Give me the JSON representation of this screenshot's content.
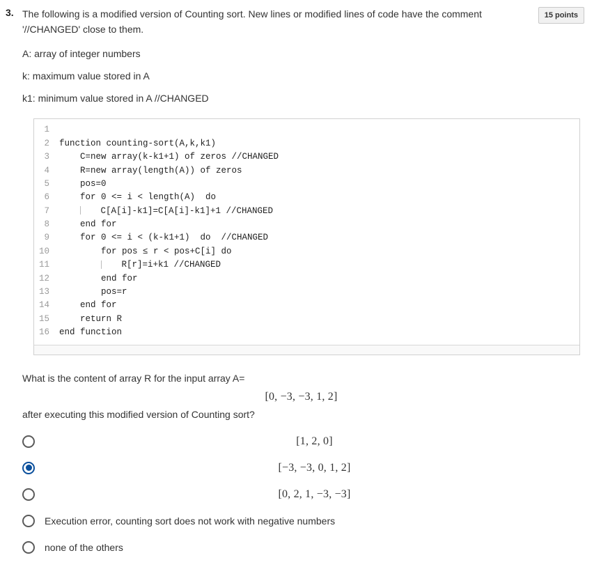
{
  "question": {
    "number": "3.",
    "points": "15 points",
    "intro1": "The following is a modified version of Counting sort. New lines or modified lines of code have the comment",
    "intro2": "'//CHANGED' close to them.",
    "defA": "A: array of integer numbers",
    "defK": "k: maximum value stored in A",
    "defK1": "k1: minimum value stored in A //CHANGED"
  },
  "code": [
    {
      "n": "1",
      "t": ""
    },
    {
      "n": "2",
      "t": "function counting-sort(A,k,k1)"
    },
    {
      "n": "3",
      "t": "    C=new array(k-k1+1) of zeros //CHANGED"
    },
    {
      "n": "4",
      "t": "    R=new array(length(A)) of zeros"
    },
    {
      "n": "5",
      "t": "    pos=0"
    },
    {
      "n": "6",
      "t": "    for 0 <= i < length(A)  do"
    },
    {
      "n": "7",
      "t": "        C[A[i]-k1]=C[A[i]-k1]+1 //CHANGED",
      "pipe": true
    },
    {
      "n": "8",
      "t": "    end for"
    },
    {
      "n": "9",
      "t": "    for 0 <= i < (k-k1+1)  do  //CHANGED"
    },
    {
      "n": "10",
      "t": "        for pos ≤ r < pos+C[i] do"
    },
    {
      "n": "11",
      "t": "            R[r]=i+k1 //CHANGED",
      "pipe": true
    },
    {
      "n": "12",
      "t": "        end for"
    },
    {
      "n": "13",
      "t": "        pos=r"
    },
    {
      "n": "14",
      "t": "    end for"
    },
    {
      "n": "15",
      "t": "    return R"
    },
    {
      "n": "16",
      "t": "end function"
    }
  ],
  "prompt": {
    "line1": "What is the content of array R for the input array A=",
    "arrayA": "[0, −3, −3, 1, 2]",
    "line2": "after executing this modified version of Counting sort?"
  },
  "options": [
    {
      "text": "[1, 2, 0]",
      "math": true,
      "selected": false
    },
    {
      "text": "[−3, −3, 0, 1, 2]",
      "math": true,
      "selected": true
    },
    {
      "text": "[0, 2, 1, −3, −3]",
      "math": true,
      "selected": false
    },
    {
      "text": "Execution error, counting sort does not work with negative numbers",
      "math": false,
      "selected": false
    },
    {
      "text": "none of the others",
      "math": false,
      "selected": false
    }
  ]
}
